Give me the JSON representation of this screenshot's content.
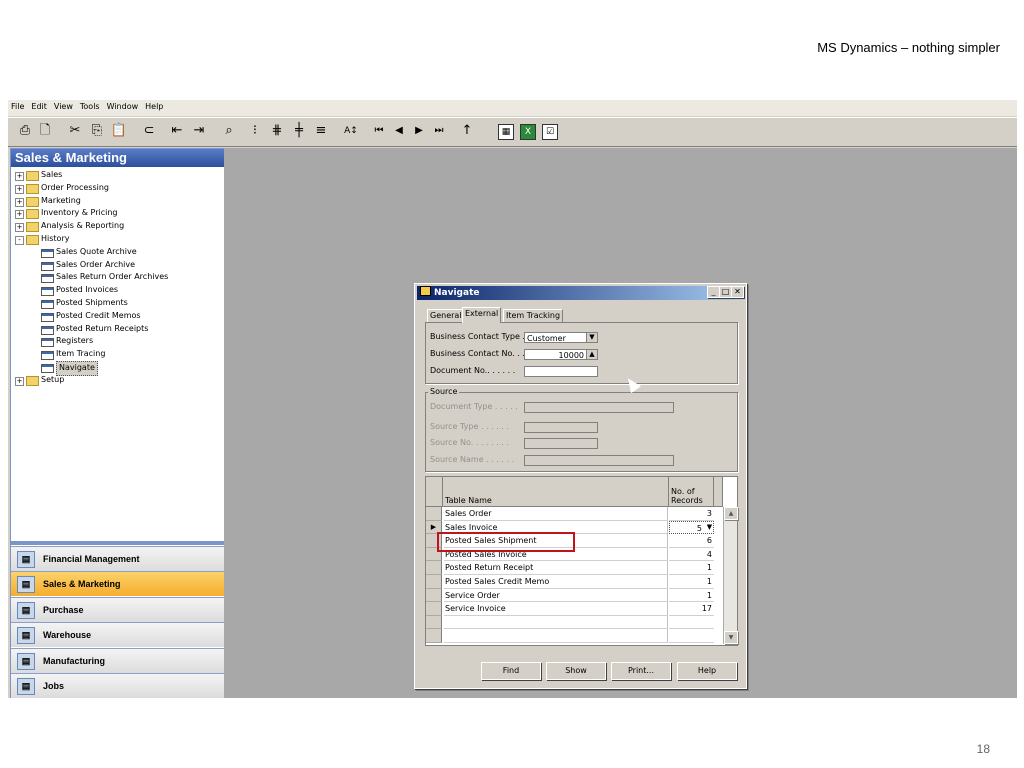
{
  "slide": {
    "header": "MS Dynamics – nothing simpler",
    "page_number": "18"
  },
  "menu": [
    "File",
    "Edit",
    "View",
    "Tools",
    "Window",
    "Help"
  ],
  "toolbar_icons": [
    "print-icon",
    "print-preview-icon",
    "cut-icon",
    "copy-icon",
    "paste-icon",
    "attach-icon",
    "indent-icon",
    "outdent-icon",
    "find-icon",
    "list-icon",
    "table-icon",
    "grid-add-icon",
    "grid-icon",
    "sort-icon",
    "first-record-icon",
    "previous-record-icon",
    "next-record-icon",
    "last-record-icon",
    "up-icon",
    "calendar-icon",
    "excel-icon",
    "checklist-icon"
  ],
  "nav_pane": {
    "title": "Sales & Marketing",
    "tree": [
      {
        "label": "Sales",
        "type": "folder",
        "level": 0,
        "expander": "+"
      },
      {
        "label": "Order Processing",
        "type": "folder",
        "level": 0,
        "expander": "+"
      },
      {
        "label": "Marketing",
        "type": "folder",
        "level": 0,
        "expander": "+"
      },
      {
        "label": "Inventory & Pricing",
        "type": "folder",
        "level": 0,
        "expander": "+"
      },
      {
        "label": "Analysis & Reporting",
        "type": "folder",
        "level": 0,
        "expander": "+"
      },
      {
        "label": "History",
        "type": "folder",
        "level": 0,
        "expander": "-"
      },
      {
        "label": "Sales Quote Archive",
        "type": "form",
        "level": 1
      },
      {
        "label": "Sales Order Archive",
        "type": "form",
        "level": 1
      },
      {
        "label": "Sales Return Order Archives",
        "type": "form",
        "level": 1
      },
      {
        "label": "Posted Invoices",
        "type": "form",
        "level": 1
      },
      {
        "label": "Posted Shipments",
        "type": "form",
        "level": 1
      },
      {
        "label": "Posted Credit Memos",
        "type": "form",
        "level": 1
      },
      {
        "label": "Posted Return Receipts",
        "type": "form",
        "level": 1
      },
      {
        "label": "Registers",
        "type": "form",
        "level": 1
      },
      {
        "label": "Item Tracing",
        "type": "form",
        "level": 1
      },
      {
        "label": "Navigate",
        "type": "form",
        "level": 1,
        "selected": true
      },
      {
        "label": "Setup",
        "type": "folder",
        "level": 0,
        "expander": "+"
      }
    ],
    "departments": [
      {
        "label": "Financial Management"
      },
      {
        "label": "Sales & Marketing",
        "active": true
      },
      {
        "label": "Purchase"
      },
      {
        "label": "Warehouse"
      },
      {
        "label": "Manufacturing"
      },
      {
        "label": "Jobs"
      }
    ]
  },
  "dialog": {
    "title": "Navigate",
    "tabs": [
      "General",
      "External",
      "Item Tracking"
    ],
    "fields": {
      "business_contact_type_label": "Business Contact Type  .",
      "business_contact_type_value": "Customer",
      "business_contact_no_label": "Business Contact No. . .",
      "business_contact_no_value": "10000",
      "document_no_label": "Document No.. . . . . .",
      "document_no_value": ""
    },
    "source": {
      "group_label": "Source",
      "document_type_label": "Document Type . . . . .",
      "source_type_label": "Source Type  . . . . . .",
      "source_no_label": "Source No.  . . . . . . .",
      "source_name_label": "Source Name  . . . . . ."
    },
    "table": {
      "headers": [
        "Table Name",
        "No. of Records"
      ],
      "rows": [
        {
          "name": "Sales Order",
          "records": "3"
        },
        {
          "name": "Sales Invoice",
          "records": "5",
          "current": true
        },
        {
          "name": "Posted Sales Shipment",
          "records": "6",
          "highlighted": true
        },
        {
          "name": "Posted Sales Invoice",
          "records": "4"
        },
        {
          "name": "Posted Return Receipt",
          "records": "1"
        },
        {
          "name": "Posted Sales Credit Memo",
          "records": "1"
        },
        {
          "name": "Service Order",
          "records": "1"
        },
        {
          "name": "Service Invoice",
          "records": "17"
        }
      ]
    },
    "buttons": [
      "Find",
      "Show",
      "Print...",
      "Help"
    ]
  },
  "colors": {
    "highlight_box": "#c0141c",
    "active_department": "#f6ad2c",
    "nav_header": "#2c4f9c"
  }
}
